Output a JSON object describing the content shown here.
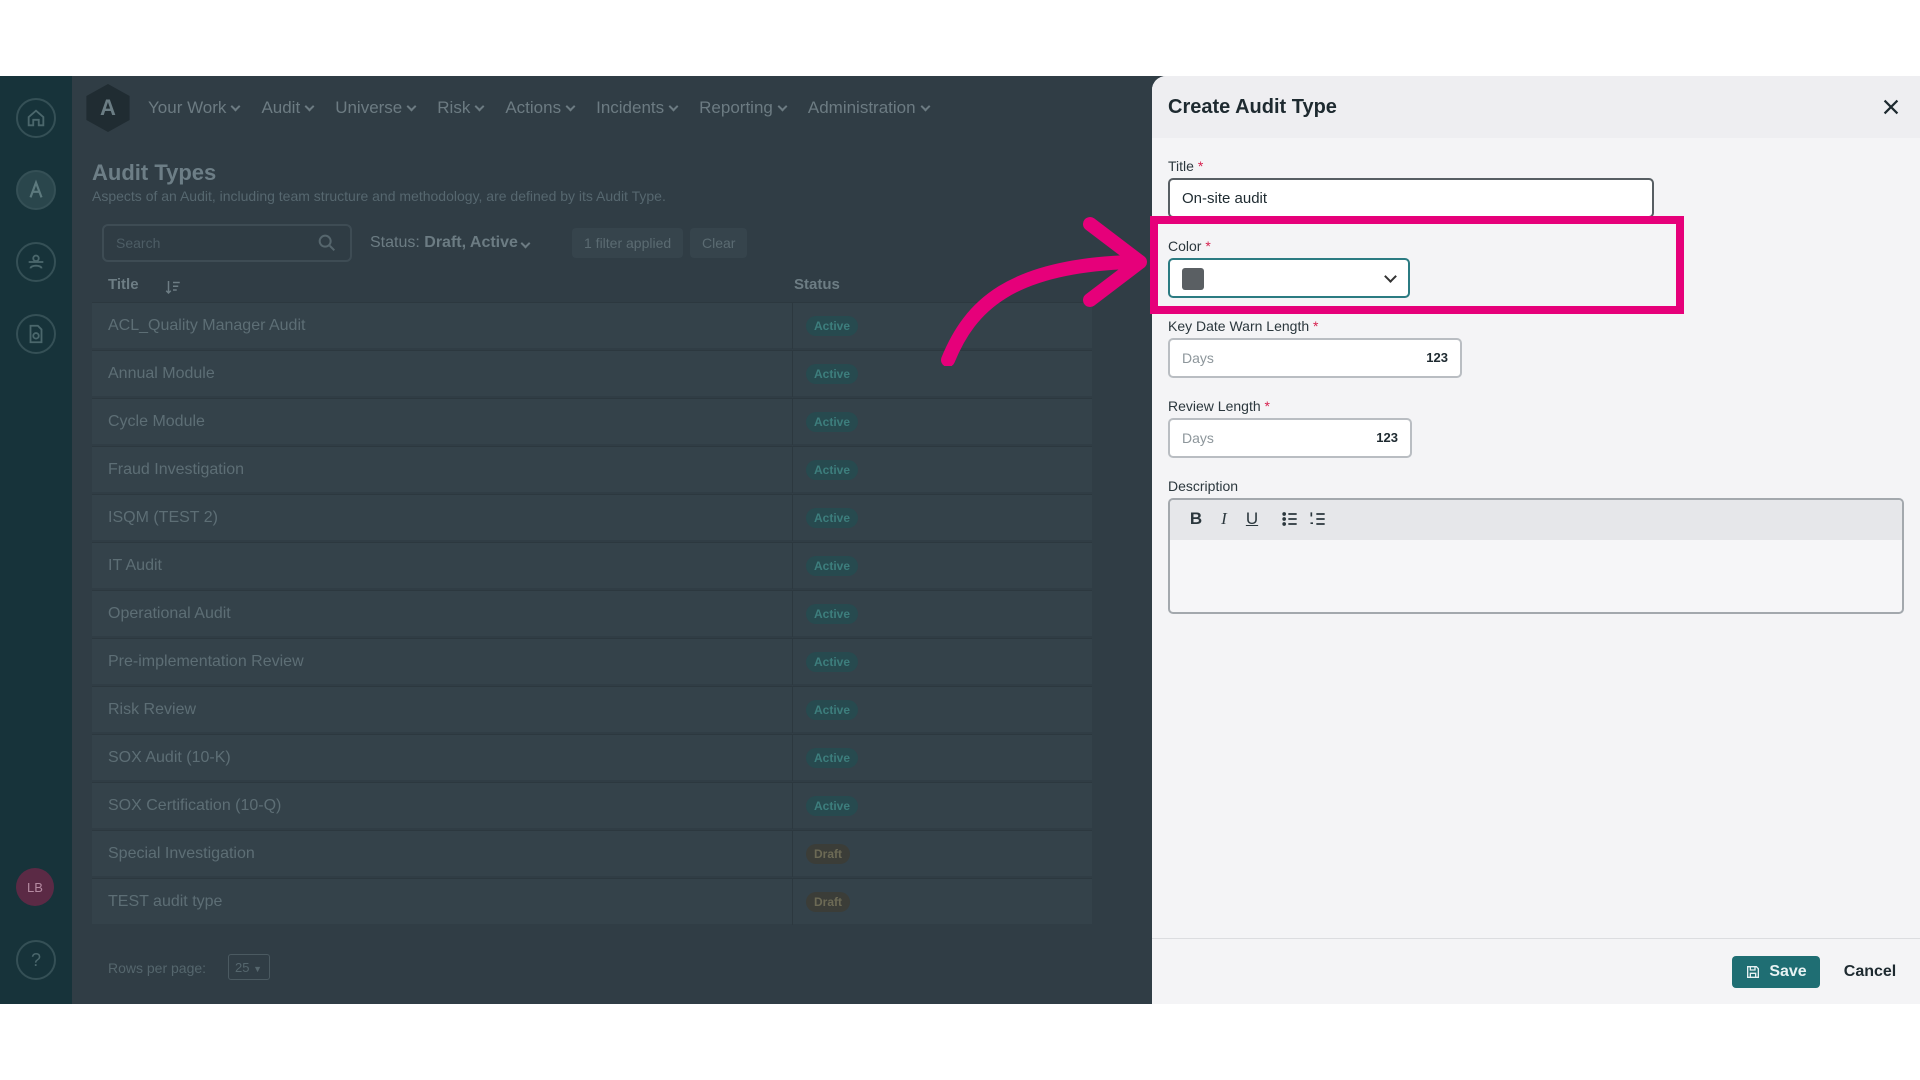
{
  "nav": {
    "logo_letter": "A",
    "items": [
      {
        "label": "Your Work"
      },
      {
        "label": "Audit"
      },
      {
        "label": "Universe"
      },
      {
        "label": "Risk"
      },
      {
        "label": "Actions"
      },
      {
        "label": "Incidents"
      },
      {
        "label": "Reporting"
      },
      {
        "label": "Administration"
      }
    ]
  },
  "rail": {
    "avatar_initials": "LB",
    "icons": [
      "home-icon",
      "app-logo-icon",
      "team-icon",
      "document-icon",
      "help-icon"
    ]
  },
  "page": {
    "title": "Audit Types",
    "subtitle": "Aspects of an Audit, including team structure and methodology, are defined by its Audit Type.",
    "search_placeholder": "Search",
    "status_label": "Status:",
    "status_value": "Draft, Active",
    "filter_chip": "1 filter applied",
    "clear_chip": "Clear"
  },
  "table": {
    "col_title": "Title",
    "col_status": "Status",
    "rows": [
      {
        "title": "ACL_Quality Manager Audit",
        "status": "Active"
      },
      {
        "title": "Annual Module",
        "status": "Active"
      },
      {
        "title": "Cycle Module",
        "status": "Active"
      },
      {
        "title": "Fraud Investigation",
        "status": "Active"
      },
      {
        "title": "ISQM (TEST 2)",
        "status": "Active"
      },
      {
        "title": "IT Audit",
        "status": "Active"
      },
      {
        "title": "Operational Audit",
        "status": "Active"
      },
      {
        "title": "Pre-implementation Review",
        "status": "Active"
      },
      {
        "title": "Risk Review",
        "status": "Active"
      },
      {
        "title": "SOX Audit (10-K)",
        "status": "Active"
      },
      {
        "title": "SOX Certification (10-Q)",
        "status": "Active"
      },
      {
        "title": "Special Investigation",
        "status": "Draft"
      },
      {
        "title": "TEST audit type",
        "status": "Draft"
      }
    ],
    "rows_per_page_label": "Rows per page:",
    "rows_per_page_value": "25"
  },
  "panel": {
    "title": "Create Audit Type",
    "title_label": "Title",
    "title_value": "On-site audit",
    "required_mark": "*",
    "color_label": "Color",
    "color_value": "#5a5f63",
    "warn_label": "Key Date Warn Length",
    "warn_placeholder": "Days",
    "warn_suffix": "123",
    "review_label": "Review Length",
    "review_placeholder": "Days",
    "review_suffix": "123",
    "description_label": "Description",
    "toolbar": {
      "bold": "B",
      "italic": "I",
      "underline": "U"
    },
    "save_label": "Save",
    "cancel_label": "Cancel"
  },
  "colors": {
    "accent": "#1f6e73",
    "highlight": "#e6007a",
    "required": "#d61f4d"
  }
}
